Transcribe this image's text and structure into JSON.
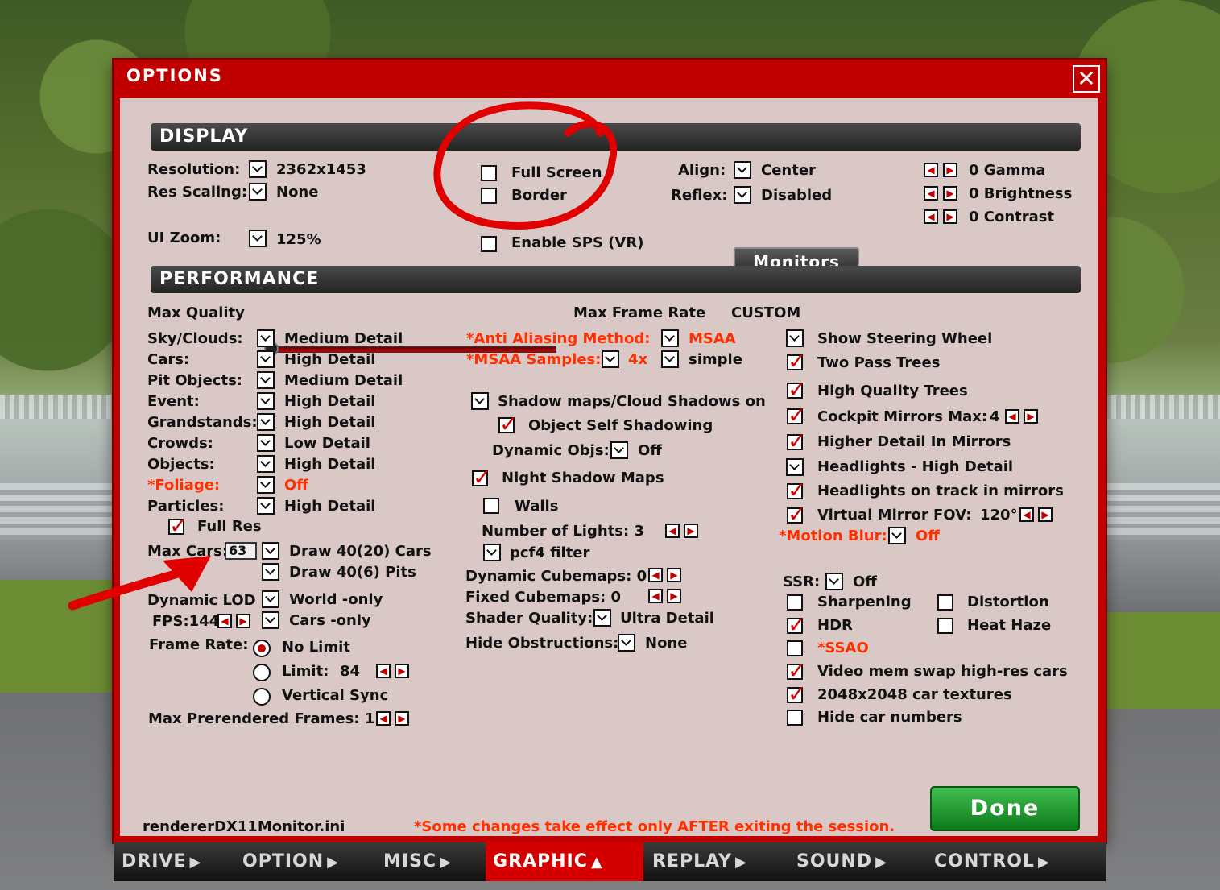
{
  "dialog": {
    "title": "OPTIONS",
    "close_icon": "close-icon"
  },
  "display": {
    "header": "DISPLAY",
    "resolution_label": "Resolution:",
    "resolution_value": "2362x1453",
    "res_scaling_label": "Res Scaling:",
    "res_scaling_value": "None",
    "ui_zoom_label": "UI Zoom:",
    "ui_zoom_value": "125%",
    "full_screen": "Full Screen",
    "border": "Border",
    "enable_sps": "Enable SPS (VR)",
    "align_label": "Align:",
    "align_value": "Center",
    "reflex_label": "Reflex:",
    "reflex_value": "Disabled",
    "monitors_button": "Monitors",
    "gamma": "0  Gamma",
    "brightness": "0  Brightness",
    "contrast": "0  Contrast"
  },
  "performance": {
    "header": "PERFORMANCE",
    "max_quality": "Max Quality",
    "max_frame_rate": "Max Frame Rate",
    "custom": "CUSTOM",
    "rows": [
      {
        "label": "Sky/Clouds:",
        "value": "Medium Detail"
      },
      {
        "label": "Cars:",
        "value": "High Detail"
      },
      {
        "label": "Pit Objects:",
        "value": "Medium Detail"
      },
      {
        "label": "Event:",
        "value": "High Detail"
      },
      {
        "label": "Grandstands:",
        "value": "High Detail"
      },
      {
        "label": "Crowds:",
        "value": "Low Detail"
      },
      {
        "label": "Objects:",
        "value": "High Detail"
      },
      {
        "label": "*Foliage:",
        "value": "Off"
      },
      {
        "label": "Particles:",
        "value": "High Detail"
      }
    ],
    "full_res": "Full Res",
    "max_cars_label": "Max Cars:",
    "max_cars_value": "63",
    "draw_cars": "Draw 40(20) Cars",
    "draw_pits": "Draw 40(6) Pits",
    "dynamic_lod": "Dynamic LOD",
    "fps": "FPS:144",
    "world_only": "World -only",
    "cars_only": "Cars -only",
    "frame_rate_label": "Frame Rate:",
    "no_limit": "No Limit",
    "limit": "Limit:",
    "limit_value": "84",
    "vertical_sync": "Vertical Sync",
    "max_prerendered": "Max Prerendered Frames: 1",
    "aa_method_label": "*Anti Aliasing Method:",
    "aa_method_value": "MSAA",
    "msaa_samples_label": "*MSAA Samples:",
    "msaa_samples_value": "4x",
    "msaa_simple": "simple",
    "shadow_maps": "Shadow maps/Cloud Shadows on",
    "object_self_shadowing": "Object Self Shadowing",
    "dynamic_objs_label": "Dynamic Objs:",
    "dynamic_objs_value": "Off",
    "night_shadow_maps": "Night Shadow Maps",
    "walls": "Walls",
    "number_of_lights": "Number of Lights: 3",
    "pcf4_filter": "pcf4 filter",
    "dynamic_cubemaps": "Dynamic Cubemaps: 0",
    "fixed_cubemaps": "Fixed Cubemaps: 0",
    "shader_quality_label": "Shader Quality:",
    "shader_quality_value": "Ultra Detail",
    "hide_obstructions_label": "Hide Obstructions:",
    "hide_obstructions_value": "None",
    "show_steering_wheel": "Show Steering Wheel",
    "two_pass_trees": "Two Pass Trees",
    "high_quality_trees": "High Quality Trees",
    "cockpit_mirrors": "Cockpit Mirrors  Max:",
    "cockpit_mirrors_value": "4",
    "higher_detail_mirrors": "Higher Detail In Mirrors",
    "headlights_high": "Headlights - High Detail",
    "headlights_track": "Headlights on track in mirrors",
    "virtual_mirror": "Virtual Mirror  FOV:",
    "virtual_mirror_fov": "120°",
    "motion_blur_label": "*Motion Blur:",
    "motion_blur_value": "Off",
    "ssr_label": "SSR:",
    "ssr_value": "Off",
    "sharpening": "Sharpening",
    "distortion": "Distortion",
    "hdr": "HDR",
    "heat_haze": "Heat Haze",
    "ssao": "*SSAO",
    "video_mem_swap": "Video mem swap high-res cars",
    "car_textures": "2048x2048 car textures",
    "hide_car_numbers": "Hide car numbers"
  },
  "footer": {
    "ini_file": "rendererDX11Monitor.ini",
    "note": "*Some changes take effect only AFTER exiting the session.",
    "done_button": "Done"
  },
  "tabs": [
    {
      "label": "DRIVE",
      "icon": "triangle-right-icon"
    },
    {
      "label": "OPTION",
      "icon": "triangle-right-icon"
    },
    {
      "label": "MISC",
      "icon": "triangle-right-icon"
    },
    {
      "label": "GRAPHIC",
      "icon": "triangle-up-icon",
      "active": true
    },
    {
      "label": "REPLAY",
      "icon": "triangle-right-icon"
    },
    {
      "label": "SOUND",
      "icon": "triangle-right-icon"
    },
    {
      "label": "CONTROL",
      "icon": "triangle-right-icon"
    }
  ],
  "colors": {
    "accent": "#c00000",
    "warning_text": "#ff3000",
    "done": "#1f9a2e"
  }
}
